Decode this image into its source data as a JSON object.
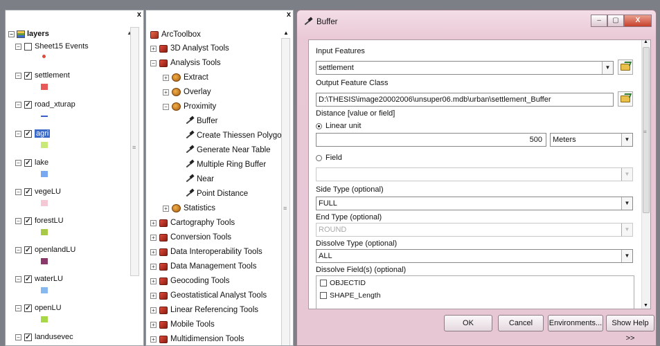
{
  "layers_panel": {
    "close_label": "x",
    "root_label": "layers",
    "layers": [
      {
        "name": "Sheet15 Events",
        "checked": false,
        "swatch": "#e04a3a",
        "swatch_kind": "dot"
      },
      {
        "name": "settlement",
        "checked": true,
        "swatch": "#e85a5a",
        "swatch_kind": "fill"
      },
      {
        "name": "road_xturap",
        "checked": true,
        "swatch": "#3a5ec8",
        "swatch_kind": "line"
      },
      {
        "name": "agri",
        "checked": true,
        "swatch": "#c8e878",
        "swatch_kind": "fill",
        "selected": true
      },
      {
        "name": "lake",
        "checked": true,
        "swatch": "#78a8f0",
        "swatch_kind": "fill"
      },
      {
        "name": "vegeLU",
        "checked": true,
        "swatch": "#f4c8d4",
        "swatch_kind": "fill"
      },
      {
        "name": "forestLU",
        "checked": true,
        "swatch": "#a8c848",
        "swatch_kind": "fill"
      },
      {
        "name": "openlandLU",
        "checked": true,
        "swatch": "#8a3a6a",
        "swatch_kind": "fill"
      },
      {
        "name": "waterLU",
        "checked": true,
        "swatch": "#88b8f0",
        "swatch_kind": "fill"
      },
      {
        "name": "openLU",
        "checked": true,
        "swatch": "#a8d848",
        "swatch_kind": "fill"
      },
      {
        "name": "landusevec",
        "checked": true,
        "swatch": "",
        "swatch_kind": "none"
      }
    ]
  },
  "toolbox_panel": {
    "close_label": "x",
    "root_label": "ArcToolbox",
    "items": [
      {
        "label": "3D Analyst Tools",
        "depth": 0,
        "icon": "toolbox-icon",
        "expander": "+"
      },
      {
        "label": "Analysis Tools",
        "depth": 0,
        "icon": "toolbox-icon",
        "expander": "-"
      },
      {
        "label": "Extract",
        "depth": 1,
        "icon": "toolset-icon",
        "expander": "+"
      },
      {
        "label": "Overlay",
        "depth": 1,
        "icon": "toolset-icon",
        "expander": "+"
      },
      {
        "label": "Proximity",
        "depth": 1,
        "icon": "toolset-icon",
        "expander": "-"
      },
      {
        "label": "Buffer",
        "depth": 2,
        "icon": "hammer-icon",
        "expander": ""
      },
      {
        "label": "Create Thiessen Polygons",
        "depth": 2,
        "icon": "hammer-icon",
        "expander": ""
      },
      {
        "label": "Generate Near Table",
        "depth": 2,
        "icon": "hammer-icon",
        "expander": ""
      },
      {
        "label": "Multiple Ring Buffer",
        "depth": 2,
        "icon": "script-icon",
        "expander": ""
      },
      {
        "label": "Near",
        "depth": 2,
        "icon": "hammer-icon",
        "expander": ""
      },
      {
        "label": "Point Distance",
        "depth": 2,
        "icon": "hammer-icon",
        "expander": ""
      },
      {
        "label": "Statistics",
        "depth": 1,
        "icon": "toolset-icon",
        "expander": "+"
      },
      {
        "label": "Cartography Tools",
        "depth": 0,
        "icon": "toolbox-icon",
        "expander": "+"
      },
      {
        "label": "Conversion Tools",
        "depth": 0,
        "icon": "toolbox-icon",
        "expander": "+"
      },
      {
        "label": "Data Interoperability Tools",
        "depth": 0,
        "icon": "toolbox-icon",
        "expander": "+"
      },
      {
        "label": "Data Management Tools",
        "depth": 0,
        "icon": "toolbox-icon",
        "expander": "+"
      },
      {
        "label": "Geocoding Tools",
        "depth": 0,
        "icon": "toolbox-icon",
        "expander": "+"
      },
      {
        "label": "Geostatistical Analyst Tools",
        "depth": 0,
        "icon": "toolbox-icon",
        "expander": "+"
      },
      {
        "label": "Linear Referencing Tools",
        "depth": 0,
        "icon": "toolbox-icon",
        "expander": "+"
      },
      {
        "label": "Mobile Tools",
        "depth": 0,
        "icon": "toolbox-icon",
        "expander": "+"
      },
      {
        "label": "Multidimension Tools",
        "depth": 0,
        "icon": "toolbox-icon",
        "expander": "+"
      }
    ]
  },
  "dialog": {
    "title": "Buffer",
    "window_buttons": {
      "minimize": "–",
      "maximize": "▢",
      "close": "X"
    },
    "input_features_label": "Input Features",
    "input_features_value": "settlement",
    "output_class_label": "Output Feature Class",
    "output_class_value": "D:\\THESIS\\image20002006\\unsuper06.mdb\\urban\\settlement_Buffer",
    "distance_label": "Distance [value or field]",
    "linear_unit_label": "Linear unit",
    "distance_value": "500",
    "unit_value": "Meters",
    "field_label": "Field",
    "field_value": "",
    "side_type_label": "Side Type (optional)",
    "side_type_value": "FULL",
    "end_type_label": "End Type (optional)",
    "end_type_value": "ROUND",
    "dissolve_type_label": "Dissolve Type (optional)",
    "dissolve_type_value": "ALL",
    "dissolve_fields_label": "Dissolve Field(s) (optional)",
    "dissolve_fields": [
      "OBJECTID",
      "SHAPE_Length"
    ],
    "buttons": {
      "ok": "OK",
      "cancel": "Cancel",
      "environments": "Environments...",
      "show_help": "Show Help >>"
    }
  }
}
